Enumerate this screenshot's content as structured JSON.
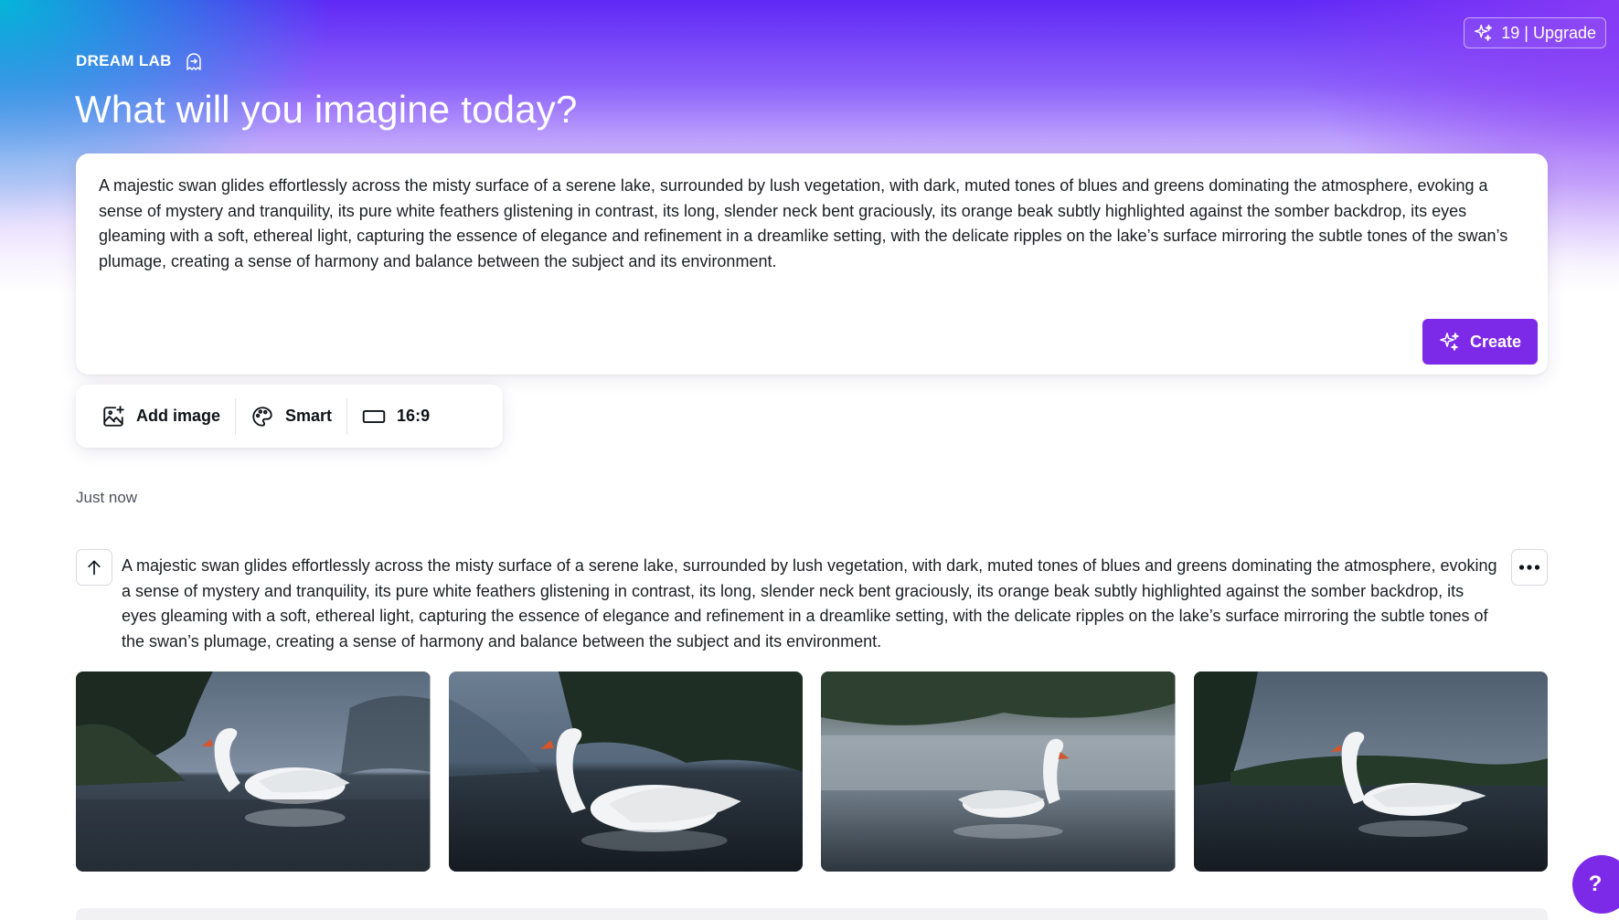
{
  "account": {
    "upgrade_label": "19 | Upgrade",
    "icon": "sparkle-icon"
  },
  "brand": {
    "label": "DREAM LAB",
    "icon": "ghost-chat-icon"
  },
  "headline": "What will you imagine today?",
  "prompt": {
    "text": "A majestic swan glides effortlessly across the misty surface of a serene lake, surrounded by lush vegetation, with dark, muted tones of blues and greens dominating the atmosphere, evoking a sense of mystery and tranquility, its pure white feathers glistening in contrast, its long, slender neck bent graciously, its orange beak subtly highlighted against the somber backdrop, its eyes gleaming with a soft, ethereal light, capturing the essence of elegance and refinement in a dreamlike setting, with the delicate ripples on the lake’s surface mirroring the subtle tones of the swan’s plumage, creating a sense of harmony and balance between the subject and its environment.",
    "create_label": "Create"
  },
  "options": {
    "add_image": "Add image",
    "style": "Smart",
    "aspect_ratio": "16:9"
  },
  "history": {
    "timestamp": "Just now",
    "prompt_text": "A majestic swan glides effortlessly across the misty surface of a serene lake, surrounded by lush vegetation, with dark, muted tones of blues and greens dominating the atmosphere, evoking a sense of mystery and tranquility, its pure white feathers glistening in contrast, its long, slender neck bent graciously, its orange beak subtly highlighted against the somber backdrop, its eyes gleaming with a soft, ethereal light, capturing the essence of elegance and refinement in a dreamlike setting, with the delicate ripples on the lake’s surface mirroring the subtle tones of the swan’s plumage, creating a sense of harmony and balance between the subject and its environment.",
    "results_count": 4
  },
  "help_label": "?",
  "colors": {
    "accent": "#7d2ae8",
    "gradient_cyan": "#00bed7",
    "gradient_violet": "#5f28f5"
  }
}
